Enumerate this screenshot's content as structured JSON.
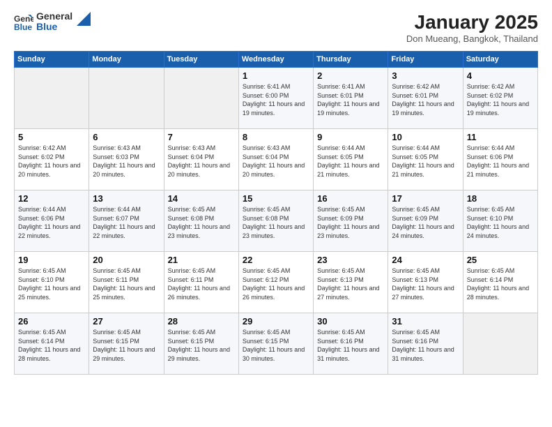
{
  "logo": {
    "general": "General",
    "blue": "Blue"
  },
  "title": "January 2025",
  "location": "Don Mueang, Bangkok, Thailand",
  "days_of_week": [
    "Sunday",
    "Monday",
    "Tuesday",
    "Wednesday",
    "Thursday",
    "Friday",
    "Saturday"
  ],
  "weeks": [
    [
      {
        "day": "",
        "info": ""
      },
      {
        "day": "",
        "info": ""
      },
      {
        "day": "",
        "info": ""
      },
      {
        "day": "1",
        "info": "Sunrise: 6:41 AM\nSunset: 6:00 PM\nDaylight: 11 hours and 19 minutes."
      },
      {
        "day": "2",
        "info": "Sunrise: 6:41 AM\nSunset: 6:01 PM\nDaylight: 11 hours and 19 minutes."
      },
      {
        "day": "3",
        "info": "Sunrise: 6:42 AM\nSunset: 6:01 PM\nDaylight: 11 hours and 19 minutes."
      },
      {
        "day": "4",
        "info": "Sunrise: 6:42 AM\nSunset: 6:02 PM\nDaylight: 11 hours and 19 minutes."
      }
    ],
    [
      {
        "day": "5",
        "info": "Sunrise: 6:42 AM\nSunset: 6:02 PM\nDaylight: 11 hours and 20 minutes."
      },
      {
        "day": "6",
        "info": "Sunrise: 6:43 AM\nSunset: 6:03 PM\nDaylight: 11 hours and 20 minutes."
      },
      {
        "day": "7",
        "info": "Sunrise: 6:43 AM\nSunset: 6:04 PM\nDaylight: 11 hours and 20 minutes."
      },
      {
        "day": "8",
        "info": "Sunrise: 6:43 AM\nSunset: 6:04 PM\nDaylight: 11 hours and 20 minutes."
      },
      {
        "day": "9",
        "info": "Sunrise: 6:44 AM\nSunset: 6:05 PM\nDaylight: 11 hours and 21 minutes."
      },
      {
        "day": "10",
        "info": "Sunrise: 6:44 AM\nSunset: 6:05 PM\nDaylight: 11 hours and 21 minutes."
      },
      {
        "day": "11",
        "info": "Sunrise: 6:44 AM\nSunset: 6:06 PM\nDaylight: 11 hours and 21 minutes."
      }
    ],
    [
      {
        "day": "12",
        "info": "Sunrise: 6:44 AM\nSunset: 6:06 PM\nDaylight: 11 hours and 22 minutes."
      },
      {
        "day": "13",
        "info": "Sunrise: 6:44 AM\nSunset: 6:07 PM\nDaylight: 11 hours and 22 minutes."
      },
      {
        "day": "14",
        "info": "Sunrise: 6:45 AM\nSunset: 6:08 PM\nDaylight: 11 hours and 23 minutes."
      },
      {
        "day": "15",
        "info": "Sunrise: 6:45 AM\nSunset: 6:08 PM\nDaylight: 11 hours and 23 minutes."
      },
      {
        "day": "16",
        "info": "Sunrise: 6:45 AM\nSunset: 6:09 PM\nDaylight: 11 hours and 23 minutes."
      },
      {
        "day": "17",
        "info": "Sunrise: 6:45 AM\nSunset: 6:09 PM\nDaylight: 11 hours and 24 minutes."
      },
      {
        "day": "18",
        "info": "Sunrise: 6:45 AM\nSunset: 6:10 PM\nDaylight: 11 hours and 24 minutes."
      }
    ],
    [
      {
        "day": "19",
        "info": "Sunrise: 6:45 AM\nSunset: 6:10 PM\nDaylight: 11 hours and 25 minutes."
      },
      {
        "day": "20",
        "info": "Sunrise: 6:45 AM\nSunset: 6:11 PM\nDaylight: 11 hours and 25 minutes."
      },
      {
        "day": "21",
        "info": "Sunrise: 6:45 AM\nSunset: 6:11 PM\nDaylight: 11 hours and 26 minutes."
      },
      {
        "day": "22",
        "info": "Sunrise: 6:45 AM\nSunset: 6:12 PM\nDaylight: 11 hours and 26 minutes."
      },
      {
        "day": "23",
        "info": "Sunrise: 6:45 AM\nSunset: 6:13 PM\nDaylight: 11 hours and 27 minutes."
      },
      {
        "day": "24",
        "info": "Sunrise: 6:45 AM\nSunset: 6:13 PM\nDaylight: 11 hours and 27 minutes."
      },
      {
        "day": "25",
        "info": "Sunrise: 6:45 AM\nSunset: 6:14 PM\nDaylight: 11 hours and 28 minutes."
      }
    ],
    [
      {
        "day": "26",
        "info": "Sunrise: 6:45 AM\nSunset: 6:14 PM\nDaylight: 11 hours and 28 minutes."
      },
      {
        "day": "27",
        "info": "Sunrise: 6:45 AM\nSunset: 6:15 PM\nDaylight: 11 hours and 29 minutes."
      },
      {
        "day": "28",
        "info": "Sunrise: 6:45 AM\nSunset: 6:15 PM\nDaylight: 11 hours and 29 minutes."
      },
      {
        "day": "29",
        "info": "Sunrise: 6:45 AM\nSunset: 6:15 PM\nDaylight: 11 hours and 30 minutes."
      },
      {
        "day": "30",
        "info": "Sunrise: 6:45 AM\nSunset: 6:16 PM\nDaylight: 11 hours and 31 minutes."
      },
      {
        "day": "31",
        "info": "Sunrise: 6:45 AM\nSunset: 6:16 PM\nDaylight: 11 hours and 31 minutes."
      },
      {
        "day": "",
        "info": ""
      }
    ]
  ]
}
